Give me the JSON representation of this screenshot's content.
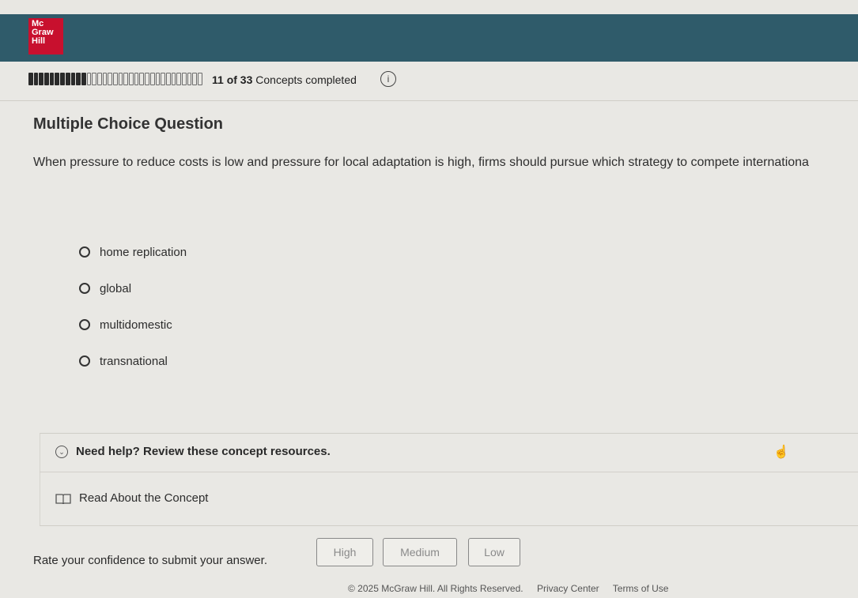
{
  "brand": {
    "logo_lines": [
      "Mc",
      "Graw",
      "Hill"
    ]
  },
  "progress": {
    "completed": 11,
    "total": 33,
    "text_count": "11 of 33",
    "text_suffix": " Concepts completed",
    "info_icon": "info-icon"
  },
  "question": {
    "heading": "Multiple Choice Question",
    "text": "When pressure to reduce costs is low and pressure for local adaptation is high, firms should pursue which strategy to compete internationa",
    "options": [
      {
        "label": "home replication"
      },
      {
        "label": "global"
      },
      {
        "label": "multidomestic"
      },
      {
        "label": "transnational"
      }
    ]
  },
  "help": {
    "title": "Need help? Review these concept resources.",
    "read_label": "Read About the Concept"
  },
  "confidence": {
    "prompt": "Rate your confidence to submit your answer.",
    "high": "High",
    "medium": "Medium",
    "low": "Low"
  },
  "footer": {
    "copyright": "© 2025 McGraw Hill. All Rights Reserved.",
    "privacy": "Privacy Center",
    "terms": "Terms of Use"
  },
  "colors": {
    "header": "#2f5b6a",
    "logo": "#c8102e",
    "background": "#e9e8e4"
  }
}
